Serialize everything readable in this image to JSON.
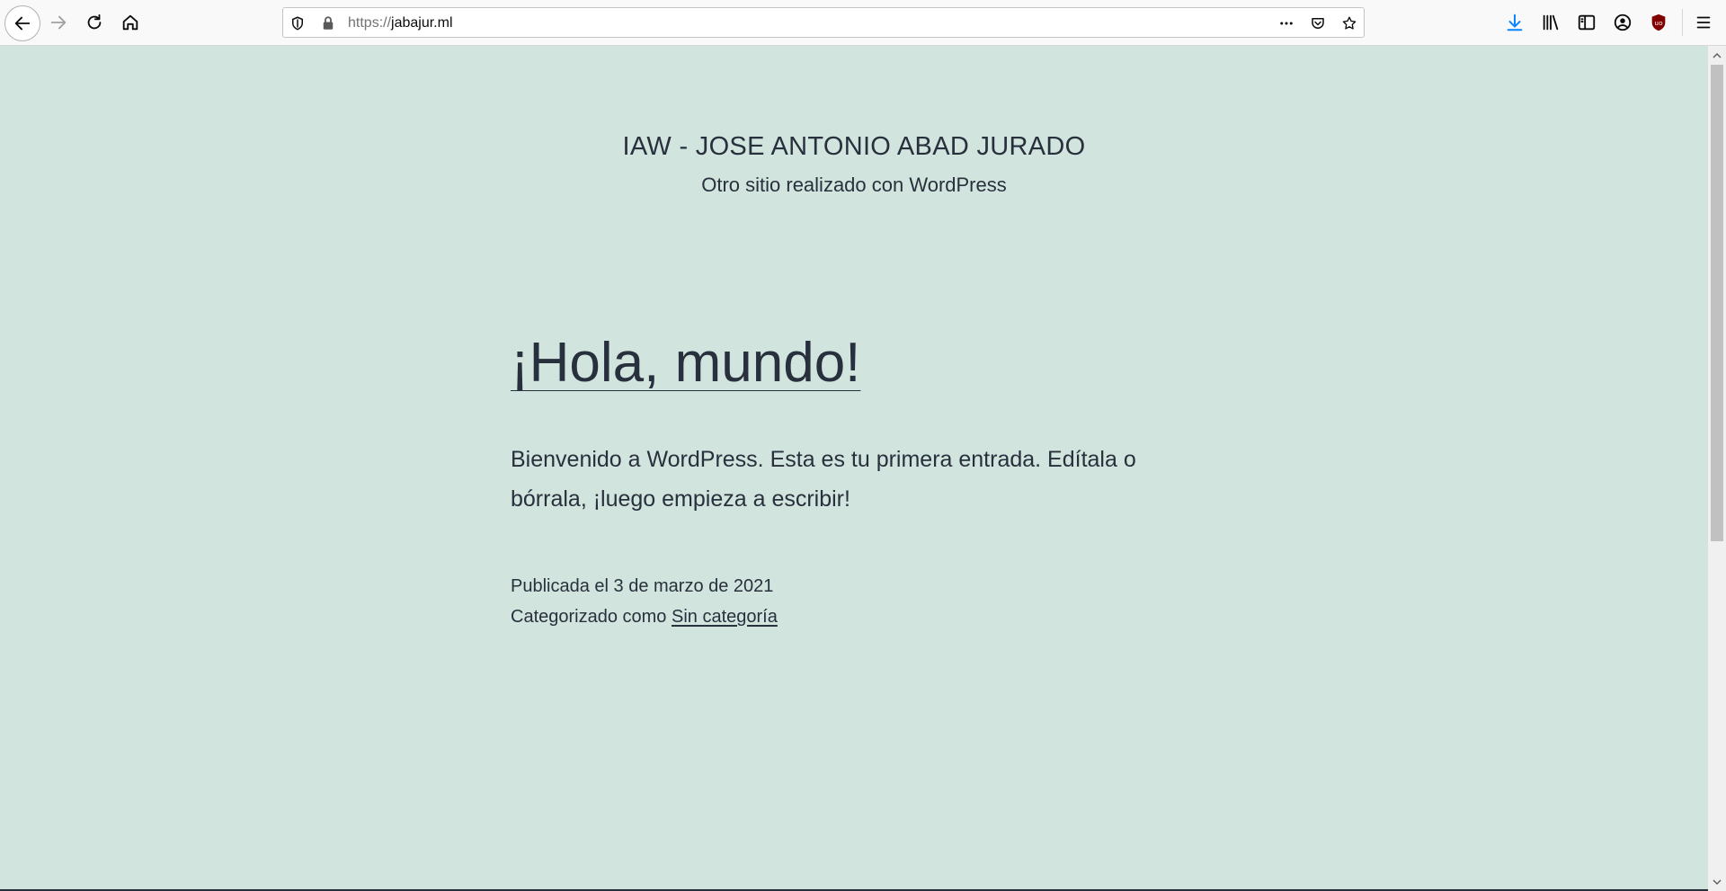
{
  "browser": {
    "url_scheme": "https://",
    "url_host": "jabajur.ml"
  },
  "site": {
    "title": "IAW - JOSE ANTONIO ABAD JURADO",
    "description": "Otro sitio realizado con WordPress"
  },
  "post": {
    "title": "¡Hola, mundo!",
    "body": "Bienvenido a WordPress. Esta es tu primera entrada. Edítala o bórrala, ¡luego empieza a escribir!",
    "published_label": "Publicada el 3 de marzo de 2021",
    "category_prefix": "Categorizado como",
    "category_link": "Sin categoría"
  },
  "colors": {
    "background": "#d1e4dd",
    "text": "#28303d",
    "download_accent": "#0a84ff",
    "ublock_red": "#800000"
  },
  "icons": [
    "back-icon",
    "forward-icon",
    "reload-icon",
    "home-icon",
    "tracking-shield-icon",
    "lock-icon",
    "more-actions-icon",
    "pocket-icon",
    "bookmark-star-icon",
    "download-icon",
    "library-icon",
    "sidebar-icon",
    "account-icon",
    "ublock-icon",
    "menu-icon"
  ]
}
